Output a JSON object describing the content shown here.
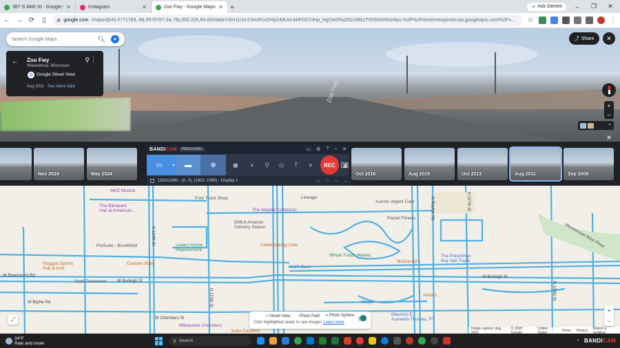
{
  "tabs": [
    {
      "title": "387 S 84th St - Google Maps",
      "color": "#34a853"
    },
    {
      "title": "Instagram",
      "color": "#e1306c"
    },
    {
      "title": "Zoo Fwy - Google Maps",
      "color": "#34a853",
      "active": true
    }
  ],
  "tabbar": {
    "gemini": "Ask Gemini"
  },
  "address": {
    "host": "google.com",
    "rest": "/maps/@43.0771783,-88.0579787,3a,75y,355.22h,83.82t/data=!3m11!1e1!3m9!1sDHp24dUnLbhFOCIUHp_Hg!2e0!5s20110801T000000!6shttps:%2F%2Fstreetviewpixels-pa.googleapis.com%2Fv..."
  },
  "search": {
    "placeholder": "Search Google Maps"
  },
  "infocard": {
    "street": "Zoo Fwy",
    "city": "Wauwatosa, Wisconsin",
    "source": "Google Street View",
    "date": "Aug 2011",
    "latest_link": "See latest date"
  },
  "streetview": {
    "road_marking": "Zoo Fwy",
    "share": "Share"
  },
  "timeline": [
    {
      "label": ""
    },
    {
      "label": "Nov 2024"
    },
    {
      "label": "May 2024"
    },
    {
      "label": "Oct 2016"
    },
    {
      "label": "Aug 2015"
    },
    {
      "label": "Oct 2013"
    },
    {
      "label": "Aug 2011",
      "selected": true
    },
    {
      "label": "Sep 2009"
    }
  ],
  "bandicam": {
    "logo_a": "BANDI",
    "logo_b": "CAM",
    "edition": "PERSONAL",
    "rec": "REC",
    "resolution": "1920x1080 - (0, 0), (1920, 1080) - Display 1"
  },
  "map_labels": {
    "mke": "MKE Muscle",
    "fork": "Fork Truck Shop",
    "banquet": "The Banquets\nHall at American...",
    "mayfair": "The Mayfair Collection",
    "lineage": "Lineage",
    "aurora": "Aurora Urgent Care",
    "planet": "Planet Fitness",
    "dml6": "DML6 Amazon\nDelivery Station",
    "petsuite": "PetSuite - Brookfield",
    "lowes": "Lowe's Home\nImprovement",
    "cottonbaking": "Cottonbaking Cafe",
    "whole": "Whole Foods Market",
    "att": "AT&T Store",
    "mcd": "McDonald's",
    "pokeshop": "The PokeShop\nBuy Sell Trade",
    "sluggos": "Sluggos Sports\nPub & Grill",
    "cousins": "Cousins Subs",
    "stark": "Stark Pavement",
    "meijer": "Meijer",
    "alioto": "Alioto's",
    "mauricio": "Mauricio E.\nAcevedo-Thomas, PT",
    "milw": "Milwaukee Choristers",
    "india": "India Gardens",
    "bluemound": "W Bluemound Rd",
    "burleigh": "W Burleigh St",
    "blythe": "W Blythe Rd",
    "chambers": "W Chambers St",
    "n124": "N 124th St",
    "n116": "N 116th St",
    "n115": "N 115th St",
    "n107": "N 107th St",
    "n104": "N 104th St",
    "n100": "N 100th St",
    "menomonee": "Menomonee River Pkwy",
    "mayfair_rd": "N Mayfair Rd",
    "burleigh2": "W Burleigh St"
  },
  "legend": {
    "streetview": "Street View",
    "photopath": "Photo Path",
    "photosphere": "Photo Sphere",
    "help": "Click highlighted areas to see images",
    "learn": "Learn more"
  },
  "attribution": {
    "imagery": "Image capture: Aug 2011",
    "copy": "© 2025 Google",
    "country": "United States",
    "terms": "Terms",
    "privacy": "Privacy",
    "report": "Report a problem"
  },
  "taskbar": {
    "temp": "34°F",
    "weather": "Rain and snow",
    "search": "Search"
  },
  "colors": {
    "sv_line": "#2e9bd6",
    "accent": "#1a73e8",
    "rec": "#e53935"
  }
}
